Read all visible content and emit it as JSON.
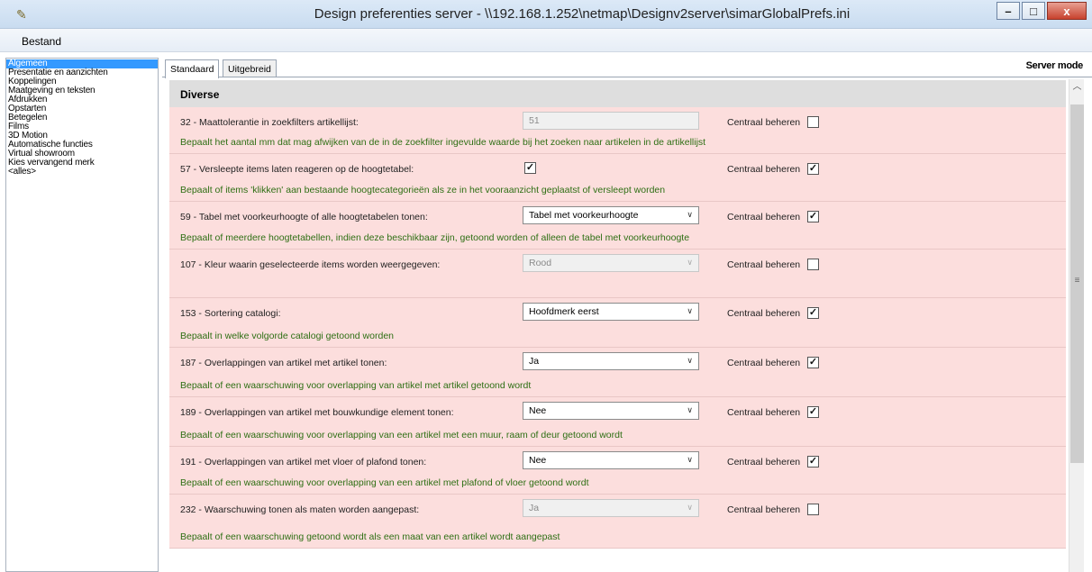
{
  "window": {
    "title": "Design preferenties server - \\\\192.168.1.252\\netmap\\Designv2server\\simarGlobalPrefs.ini",
    "minimize": "–",
    "maximize": "□",
    "close": "x"
  },
  "menu": {
    "bestand": "Bestand"
  },
  "sidebar": {
    "items": [
      {
        "label": "Algemeen",
        "selected": true
      },
      {
        "label": "Presentatie en aanzichten"
      },
      {
        "label": "Koppelingen"
      },
      {
        "label": "Maatgeving en teksten"
      },
      {
        "label": "Afdrukken"
      },
      {
        "label": "Opstarten"
      },
      {
        "label": "Betegelen"
      },
      {
        "label": "Films"
      },
      {
        "label": "3D Motion"
      },
      {
        "label": "Automatische functies"
      },
      {
        "label": "Virtual showroom"
      },
      {
        "label": "Kies vervangend merk"
      },
      {
        "label": "<alles>"
      }
    ]
  },
  "tabs": [
    "Standaard",
    "Uitgebreid"
  ],
  "server_mode": "Server mode",
  "section": {
    "title": "Diverse"
  },
  "central_label": "Centraal beheren",
  "rows": [
    {
      "label": "32 - Maattolerantie in zoekfilters artikellijst:",
      "control": "text",
      "value": "51",
      "disabled": true,
      "central": false,
      "desc": "Bepaalt het aantal mm dat mag afwijken van de in de zoekfilter ingevulde waarde bij het zoeken naar artikelen in de artikellijst"
    },
    {
      "label": "57 - Versleepte items laten reageren op de hoogtetabel:",
      "control": "checkbox",
      "checked": true,
      "central": true,
      "desc": "Bepaalt of items 'klikken' aan bestaande hoogtecategorieën als ze in het vooraanzicht geplaatst of versleept worden"
    },
    {
      "label": "59 - Tabel met voorkeurhoogte of alle hoogtetabelen tonen:",
      "control": "select",
      "value": "Tabel met voorkeurhoogte",
      "disabled": false,
      "central": true,
      "desc": "Bepaalt of meerdere hoogtetabellen, indien deze beschikbaar zijn, getoond worden of alleen de tabel met voorkeurhoogte"
    },
    {
      "label": "107 - Kleur waarin geselecteerde items worden weergegeven:",
      "control": "select",
      "value": "Rood",
      "disabled": true,
      "central": false,
      "desc": ""
    },
    {
      "label": "153 -  Sortering catalogi:",
      "control": "select",
      "value": "Hoofdmerk eerst",
      "disabled": false,
      "central": true,
      "desc": "Bepaalt in welke volgorde catalogi getoond worden"
    },
    {
      "label": "187 - Overlappingen van artikel met artikel tonen:",
      "control": "select",
      "value": "Ja",
      "disabled": false,
      "central": true,
      "desc": "Bepaalt of een waarschuwing voor overlapping van artikel met artikel getoond wordt"
    },
    {
      "label": "189 - Overlappingen van artikel met bouwkundige element tonen:",
      "control": "select",
      "value": "Nee",
      "disabled": false,
      "central": true,
      "desc": "Bepaalt of een waarschuwing voor overlapping van een artikel met een muur, raam of deur getoond wordt"
    },
    {
      "label": "191 - Overlappingen van artikel met vloer of plafond tonen:",
      "control": "select",
      "value": "Nee",
      "disabled": false,
      "central": true,
      "desc": "Bepaalt of een waarschuwing voor overlapping van een artikel met plafond of vloer getoond wordt"
    },
    {
      "label": "232 - Waarschuwing tonen als maten worden aangepast:",
      "control": "select",
      "value": "Ja",
      "disabled": true,
      "central": false,
      "desc": "Bepaalt of een waarschuwing getoond wordt als een maat van een artikel wordt aangepast"
    }
  ],
  "icons": {
    "app": "pencil-tool-icon",
    "chevron": "chevron-down-icon",
    "check": "checkmark-icon"
  }
}
